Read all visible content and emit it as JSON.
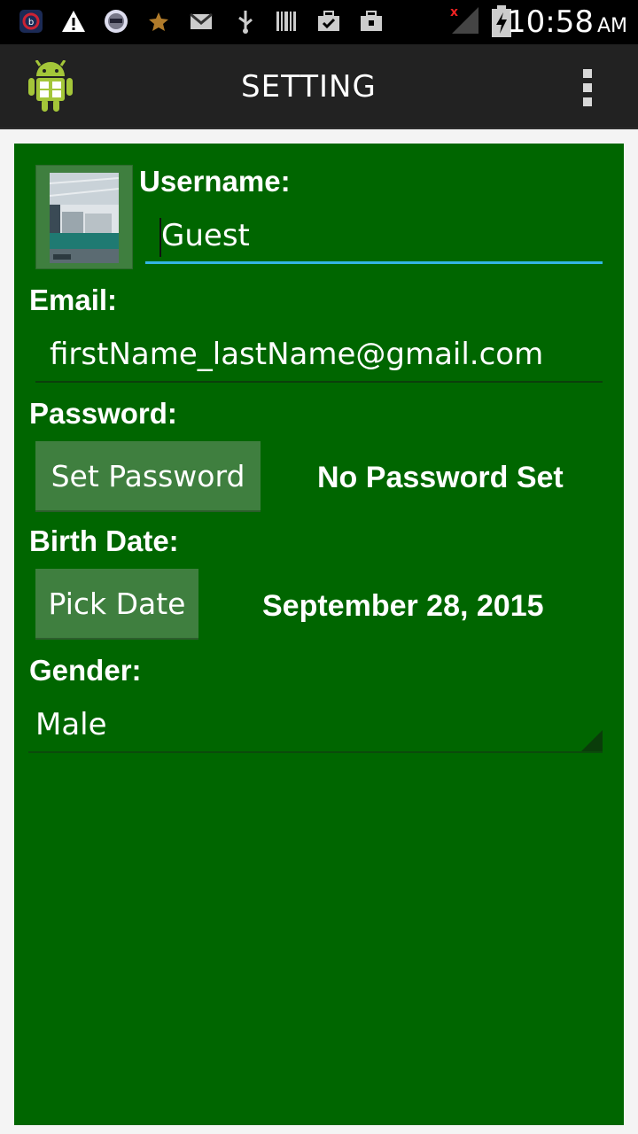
{
  "status_bar": {
    "time": "10:58",
    "ampm": "AM",
    "icons": [
      "app-notification-icon",
      "warning-icon",
      "robot-notification-icon",
      "star-icon",
      "gmail-icon",
      "usb-icon",
      "barcode-icon",
      "briefcase-check-icon",
      "briefcase-icon",
      "signal-icon",
      "battery-charging-icon"
    ]
  },
  "action_bar": {
    "title": "SETTING",
    "logo_icon": "android-logo-icon",
    "menu_icon": "overflow-menu-icon"
  },
  "form": {
    "username_label": "Username:",
    "username_value": "Guest",
    "email_label": "Email:",
    "email_value": "firstName_lastName@gmail.com",
    "password_label": "Password:",
    "set_password_button": "Set Password",
    "password_status": "No Password Set",
    "birthdate_label": "Birth Date:",
    "pick_date_button": "Pick Date",
    "birthdate_value": "September 28, 2015",
    "gender_label": "Gender:",
    "gender_value": "Male"
  },
  "colors": {
    "panel_background": "#006600",
    "button_background": "#3f7f3f",
    "focus_underline": "#33b5e5",
    "action_bar": "#222222"
  }
}
